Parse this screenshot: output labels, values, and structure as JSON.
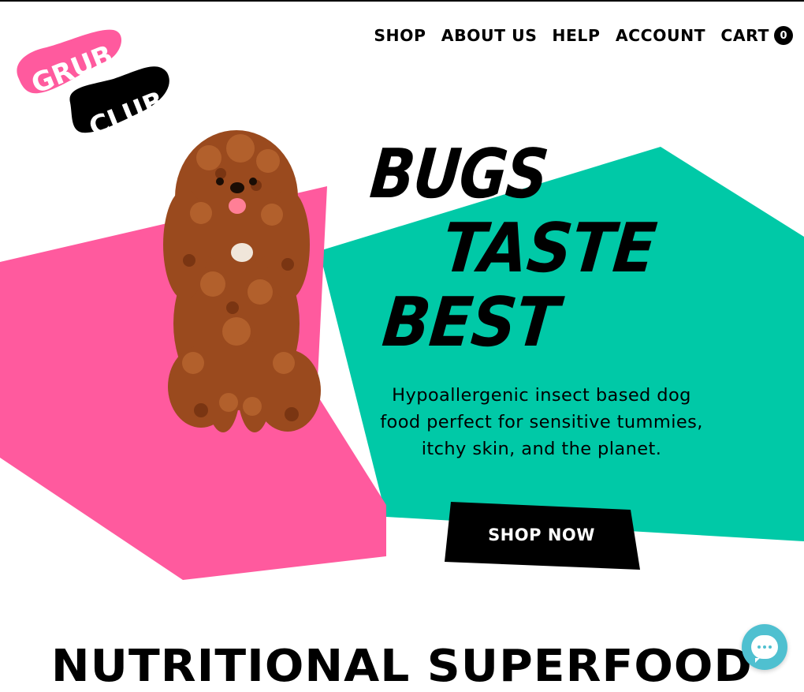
{
  "brand": {
    "logo_line1": "GRUB",
    "logo_line2": "CLUB",
    "colors": {
      "pink": "#ff5a9e",
      "teal": "#00c9a7",
      "black": "#000000"
    }
  },
  "nav": {
    "items": [
      {
        "label": "SHOP"
      },
      {
        "label": "ABOUT US"
      },
      {
        "label": "HELP"
      },
      {
        "label": "ACCOUNT"
      }
    ],
    "cart": {
      "label": "CART",
      "count": "0"
    }
  },
  "hero": {
    "headline": [
      "BUGS",
      "TASTE",
      "BEST"
    ],
    "subcopy": "Hypoallergenic insect based dog food perfect for sensitive tummies, itchy skin, and the planet.",
    "cta_label": "SHOP NOW",
    "image": "dog-photo"
  },
  "section": {
    "title": "NUTRITIONAL SUPERFOOD"
  },
  "chat": {
    "icon": "chat-icon"
  }
}
